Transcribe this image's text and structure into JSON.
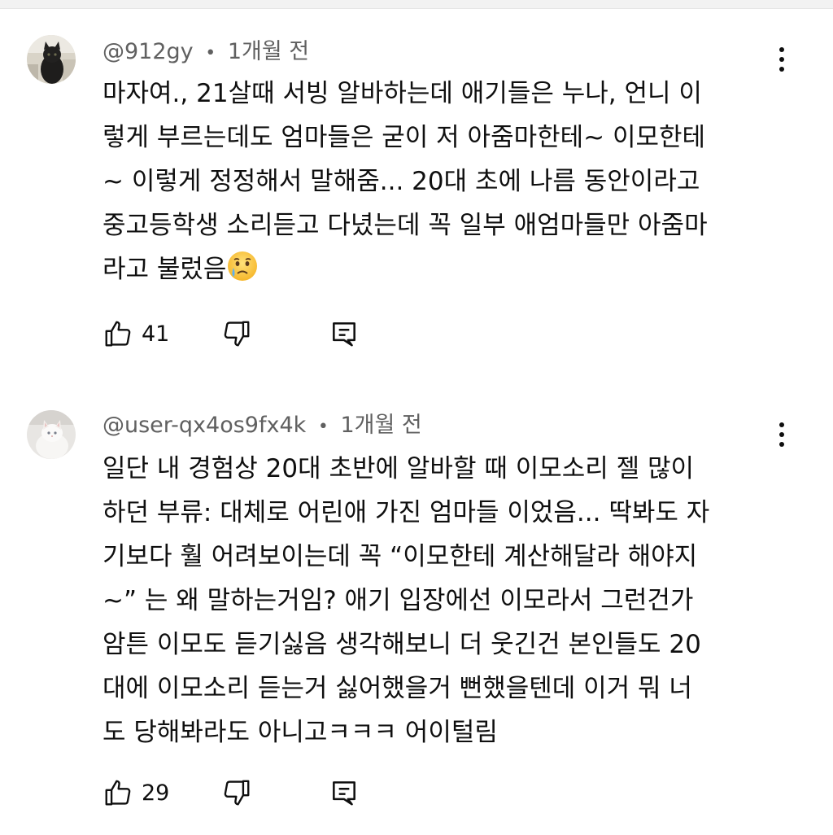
{
  "comments": [
    {
      "author": "@912gy",
      "separator": "•",
      "time": "1개월 전",
      "lines": [
        "마자여., 21살때 서빙 알바하는데 애기들은 누나, 언니 이",
        "렇게 부르는데도 엄마들은 굳이 저 아줌마한테~ 이모한테",
        "~ 이렇게 정정해서 말해줌... 20대 초에 나름 동안이라고",
        "중고등학생 소리듣고 다녔는데 꼭 일부 애엄마들만 아줌마",
        "라고 불렀음"
      ],
      "emoji": "crying-face-emoji",
      "like_count": "41"
    },
    {
      "author": "@user-qx4os9fx4k",
      "separator": "•",
      "time": "1개월 전",
      "lines": [
        "일단 내 경험상 20대 초반에 알바할 때 이모소리 젤 많이",
        "하던 부류: 대체로 어린애 가진 엄마들 이었음... 딱봐도 자",
        "기보다 훨 어려보이는데 꼭 “이모한테 계산해달라 해야지",
        "~” 는 왜 말하는거임? 애기 입장에선 이모라서 그런건가",
        "암튼 이모도 듣기싫음 생각해보니 더 웃긴건 본인들도 20",
        "대에 이모소리 듣는거 싫어했을거 뻔했을텐데 이거 뭐 너",
        "도 당해봐라도 아니고ㅋㅋㅋ 어이털림"
      ],
      "like_count": "29"
    }
  ],
  "icons": {
    "like": "thumbs-up-icon",
    "dislike": "thumbs-down-icon",
    "reply": "reply-icon",
    "more": "more-vert-icon"
  }
}
